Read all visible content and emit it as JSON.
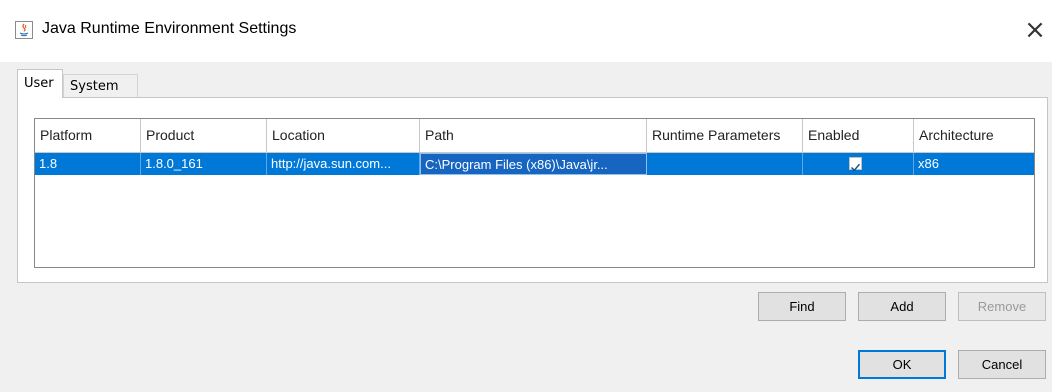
{
  "window": {
    "title": "Java Runtime Environment Settings",
    "close_glyph": "×"
  },
  "tabs": [
    {
      "label": "User",
      "active": true
    },
    {
      "label": "System",
      "active": false
    }
  ],
  "table": {
    "headers": [
      "Platform",
      "Product",
      "Location",
      "Path",
      "Runtime Parameters",
      "Enabled",
      "Architecture"
    ],
    "rows": [
      {
        "platform": "1.8",
        "product": "1.8.0_161",
        "location": "http://java.sun.com...",
        "path": "C:\\Program Files (x86)\\Java\\jr...",
        "runtime_parameters": "",
        "enabled": true,
        "architecture": "x86",
        "selected": true
      }
    ]
  },
  "buttons": {
    "find": "Find",
    "add": "Add",
    "remove": "Remove",
    "ok": "OK",
    "cancel": "Cancel"
  },
  "colors": {
    "selection": "#0078d7",
    "default_border": "#0078d7"
  },
  "icons": {
    "app": "java-icon",
    "close": "close-icon",
    "check": "checkmark-icon"
  }
}
